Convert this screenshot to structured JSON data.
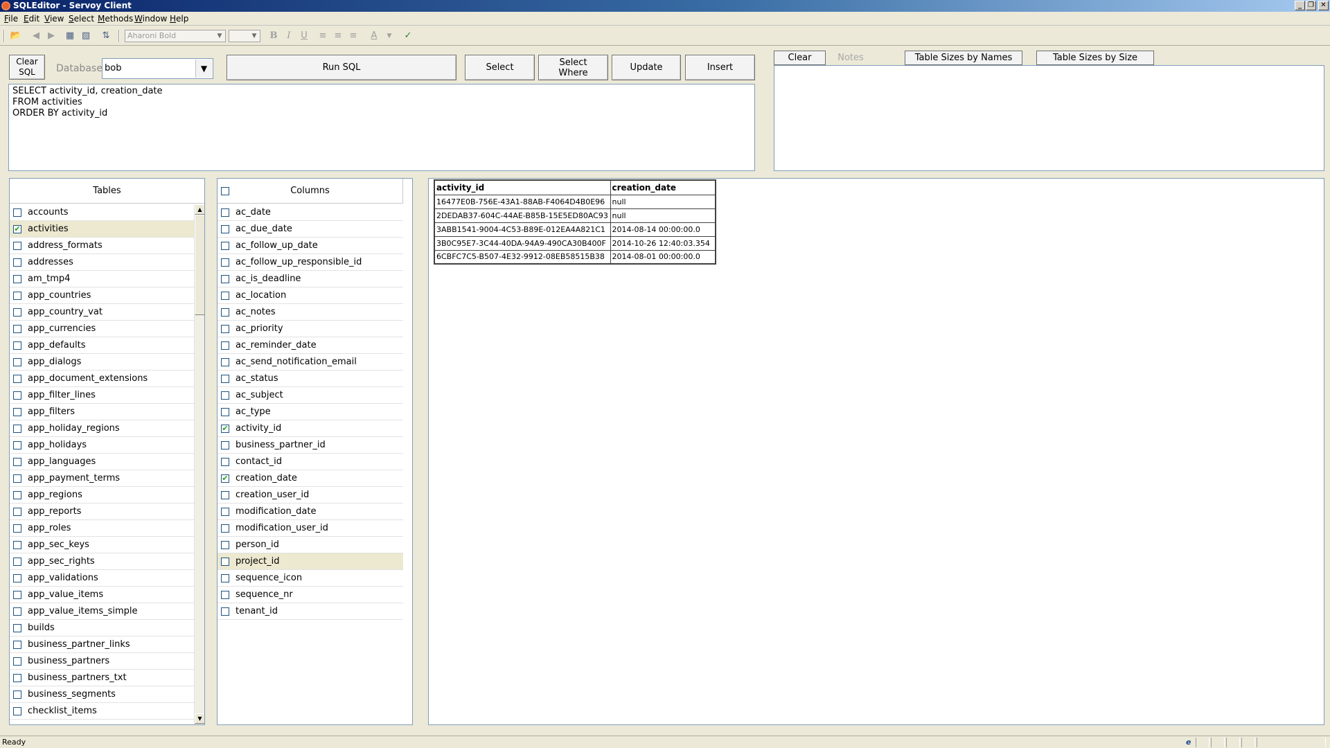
{
  "window": {
    "title": "SQLEditor - Servoy Client",
    "minimize": "_",
    "restore": "❐",
    "close": "✕"
  },
  "menu": [
    "File",
    "Edit",
    "View",
    "Select",
    "Methods",
    "Window",
    "Help"
  ],
  "toolbar": {
    "font_name": "Aharoni Bold",
    "font_size": "",
    "icons": [
      "open-folder-icon",
      "back-arrow-icon",
      "forward-arrow-icon",
      "grid-icon",
      "grid-delete-icon",
      "sort-icon",
      "bold-icon",
      "italic-icon",
      "underline-icon",
      "align-left-icon",
      "align-center-icon",
      "align-right-icon",
      "font-color-icon",
      "spellcheck-icon"
    ]
  },
  "controls": {
    "clear_sql": "Clear\nSQL",
    "database_label": "Database:",
    "database_value": "bob",
    "run_sql": "Run SQL",
    "select": "Select",
    "select_where": "Select\nWhere",
    "update": "Update",
    "insert": "Insert"
  },
  "notes_tabs": {
    "clear": "Clear",
    "notes": "Notes",
    "table_sizes_by_names": "Table Sizes by Names",
    "table_sizes_by_size": "Table Sizes by Size"
  },
  "sql_text": "SELECT activity_id, creation_date\nFROM activities\nORDER BY activity_id",
  "tables": {
    "header": "Tables",
    "items": [
      {
        "name": "accounts",
        "checked": false,
        "selected": false
      },
      {
        "name": "activities",
        "checked": true,
        "selected": true
      },
      {
        "name": "address_formats",
        "checked": false,
        "selected": false
      },
      {
        "name": "addresses",
        "checked": false,
        "selected": false
      },
      {
        "name": "am_tmp4",
        "checked": false,
        "selected": false
      },
      {
        "name": "app_countries",
        "checked": false,
        "selected": false
      },
      {
        "name": "app_country_vat",
        "checked": false,
        "selected": false
      },
      {
        "name": "app_currencies",
        "checked": false,
        "selected": false
      },
      {
        "name": "app_defaults",
        "checked": false,
        "selected": false
      },
      {
        "name": "app_dialogs",
        "checked": false,
        "selected": false
      },
      {
        "name": "app_document_extensions",
        "checked": false,
        "selected": false
      },
      {
        "name": "app_filter_lines",
        "checked": false,
        "selected": false
      },
      {
        "name": "app_filters",
        "checked": false,
        "selected": false
      },
      {
        "name": "app_holiday_regions",
        "checked": false,
        "selected": false
      },
      {
        "name": "app_holidays",
        "checked": false,
        "selected": false
      },
      {
        "name": "app_languages",
        "checked": false,
        "selected": false
      },
      {
        "name": "app_payment_terms",
        "checked": false,
        "selected": false
      },
      {
        "name": "app_regions",
        "checked": false,
        "selected": false
      },
      {
        "name": "app_reports",
        "checked": false,
        "selected": false
      },
      {
        "name": "app_roles",
        "checked": false,
        "selected": false
      },
      {
        "name": "app_sec_keys",
        "checked": false,
        "selected": false
      },
      {
        "name": "app_sec_rights",
        "checked": false,
        "selected": false
      },
      {
        "name": "app_validations",
        "checked": false,
        "selected": false
      },
      {
        "name": "app_value_items",
        "checked": false,
        "selected": false
      },
      {
        "name": "app_value_items_simple",
        "checked": false,
        "selected": false
      },
      {
        "name": "builds",
        "checked": false,
        "selected": false
      },
      {
        "name": "business_partner_links",
        "checked": false,
        "selected": false
      },
      {
        "name": "business_partners",
        "checked": false,
        "selected": false
      },
      {
        "name": "business_partners_txt",
        "checked": false,
        "selected": false
      },
      {
        "name": "business_segments",
        "checked": false,
        "selected": false
      },
      {
        "name": "checklist_items",
        "checked": false,
        "selected": false
      }
    ]
  },
  "columns": {
    "header": "Columns",
    "items": [
      {
        "name": "ac_date",
        "checked": false,
        "selected": false
      },
      {
        "name": "ac_due_date",
        "checked": false,
        "selected": false
      },
      {
        "name": "ac_follow_up_date",
        "checked": false,
        "selected": false
      },
      {
        "name": "ac_follow_up_responsible_id",
        "checked": false,
        "selected": false
      },
      {
        "name": "ac_is_deadline",
        "checked": false,
        "selected": false
      },
      {
        "name": "ac_location",
        "checked": false,
        "selected": false
      },
      {
        "name": "ac_notes",
        "checked": false,
        "selected": false
      },
      {
        "name": "ac_priority",
        "checked": false,
        "selected": false
      },
      {
        "name": "ac_reminder_date",
        "checked": false,
        "selected": false
      },
      {
        "name": "ac_send_notification_email",
        "checked": false,
        "selected": false
      },
      {
        "name": "ac_status",
        "checked": false,
        "selected": false
      },
      {
        "name": "ac_subject",
        "checked": false,
        "selected": false
      },
      {
        "name": "ac_type",
        "checked": false,
        "selected": false
      },
      {
        "name": "activity_id",
        "checked": true,
        "selected": false
      },
      {
        "name": "business_partner_id",
        "checked": false,
        "selected": false
      },
      {
        "name": "contact_id",
        "checked": false,
        "selected": false
      },
      {
        "name": "creation_date",
        "checked": true,
        "selected": false
      },
      {
        "name": "creation_user_id",
        "checked": false,
        "selected": false
      },
      {
        "name": "modification_date",
        "checked": false,
        "selected": false
      },
      {
        "name": "modification_user_id",
        "checked": false,
        "selected": false
      },
      {
        "name": "person_id",
        "checked": false,
        "selected": false
      },
      {
        "name": "project_id",
        "checked": false,
        "selected": true
      },
      {
        "name": "sequence_icon",
        "checked": false,
        "selected": false
      },
      {
        "name": "sequence_nr",
        "checked": false,
        "selected": false
      },
      {
        "name": "tenant_id",
        "checked": false,
        "selected": false
      }
    ]
  },
  "results": {
    "headers": [
      "activity_id",
      "creation_date"
    ],
    "rows": [
      [
        "16477E0B-756E-43A1-88AB-F4064D4B0E96",
        "null"
      ],
      [
        "2DEDAB37-604C-44AE-B85B-15E5ED80AC93",
        "null"
      ],
      [
        "3ABB1541-9004-4C53-B89E-012EA4A821C1",
        "2014-08-14 00:00:00.0"
      ],
      [
        "3B0C95E7-3C44-40DA-94A9-490CA30B400F",
        "2014-10-26 12:40:03.354"
      ],
      [
        "6CBFC7C5-B507-4E32-9912-08EB58515B38",
        "2014-08-01 00:00:00.0"
      ]
    ]
  },
  "status": {
    "text": "Ready",
    "ie_icon": "e"
  }
}
